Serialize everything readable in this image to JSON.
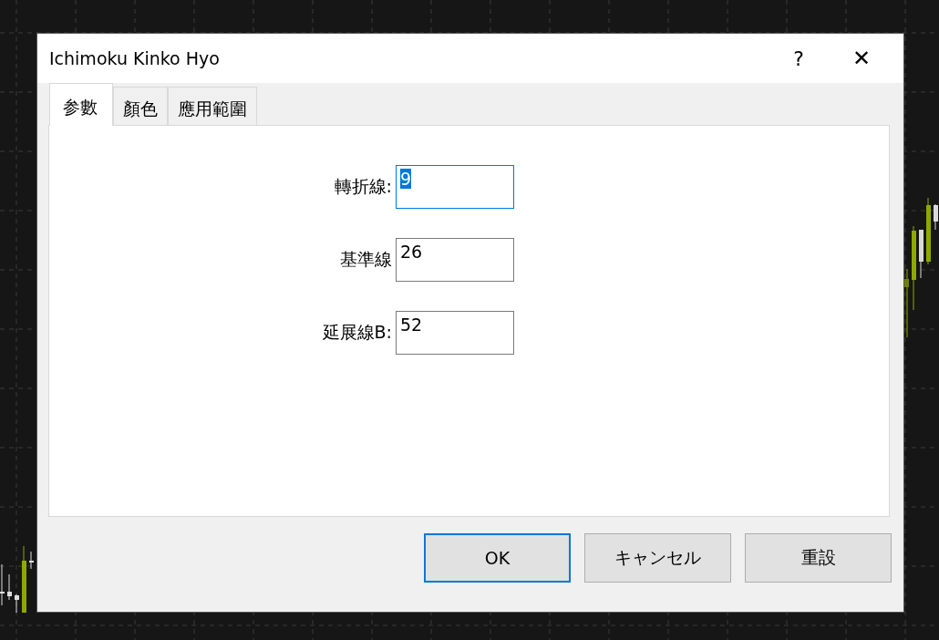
{
  "window": {
    "title": "Ichimoku Kinko Hyo",
    "help_button": "?",
    "close_button": "✕"
  },
  "tabs": [
    {
      "label": "参數",
      "selected": true
    },
    {
      "label": "顏色",
      "selected": false
    },
    {
      "label": "應用範圍",
      "selected": false
    }
  ],
  "fields": [
    {
      "label": "轉折線:",
      "value": "9",
      "focused": true
    },
    {
      "label": "基準線",
      "value": "26",
      "focused": false
    },
    {
      "label": "延展線B:",
      "value": "52",
      "focused": false
    }
  ],
  "buttons": [
    {
      "label": "OK",
      "default": true
    },
    {
      "label": "キャンセル",
      "default": false
    },
    {
      "label": "重設",
      "default": false
    }
  ]
}
